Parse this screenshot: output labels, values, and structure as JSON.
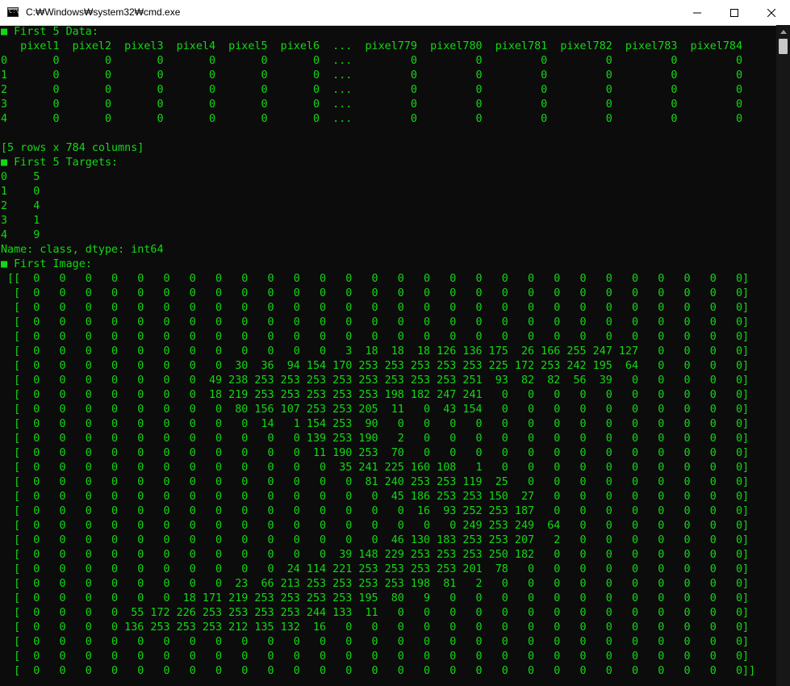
{
  "window": {
    "title": "C:₩Windows₩system32₩cmd.exe",
    "app_icon_label": "C:\\"
  },
  "console": {
    "lines": [
      "■ First 5 Data:",
      "   pixel1  pixel2  pixel3  pixel4  pixel5  pixel6  ...  pixel779  pixel780  pixel781  pixel782  pixel783  pixel784",
      "0       0       0       0       0       0       0  ...         0         0         0         0         0         0",
      "1       0       0       0       0       0       0  ...         0         0         0         0         0         0",
      "2       0       0       0       0       0       0  ...         0         0         0         0         0         0",
      "3       0       0       0       0       0       0  ...         0         0         0         0         0         0",
      "4       0       0       0       0       0       0  ...         0         0         0         0         0         0",
      "",
      "[5 rows x 784 columns]",
      "■ First 5 Targets:",
      "0    5",
      "1    0",
      "2    4",
      "3    1",
      "4    9",
      "Name: class, dtype: int64",
      "■ First Image:",
      " [[  0   0   0   0   0   0   0   0   0   0   0   0   0   0   0   0   0   0   0   0   0   0   0   0   0   0   0   0]",
      "  [  0   0   0   0   0   0   0   0   0   0   0   0   0   0   0   0   0   0   0   0   0   0   0   0   0   0   0   0]",
      "  [  0   0   0   0   0   0   0   0   0   0   0   0   0   0   0   0   0   0   0   0   0   0   0   0   0   0   0   0]",
      "  [  0   0   0   0   0   0   0   0   0   0   0   0   0   0   0   0   0   0   0   0   0   0   0   0   0   0   0   0]",
      "  [  0   0   0   0   0   0   0   0   0   0   0   0   0   0   0   0   0   0   0   0   0   0   0   0   0   0   0   0]",
      "  [  0   0   0   0   0   0   0   0   0   0   0   0   3  18  18  18 126 136 175  26 166 255 247 127   0   0   0   0]",
      "  [  0   0   0   0   0   0   0   0  30  36  94 154 170 253 253 253 253 253 225 172 253 242 195  64   0   0   0   0]",
      "  [  0   0   0   0   0   0   0  49 238 253 253 253 253 253 253 253 253 251  93  82  82  56  39   0   0   0   0   0]",
      "  [  0   0   0   0   0   0   0  18 219 253 253 253 253 253 198 182 247 241   0   0   0   0   0   0   0   0   0   0]",
      "  [  0   0   0   0   0   0   0   0  80 156 107 253 253 205  11   0  43 154   0   0   0   0   0   0   0   0   0   0]",
      "  [  0   0   0   0   0   0   0   0   0  14   1 154 253  90   0   0   0   0   0   0   0   0   0   0   0   0   0   0]",
      "  [  0   0   0   0   0   0   0   0   0   0   0 139 253 190   2   0   0   0   0   0   0   0   0   0   0   0   0   0]",
      "  [  0   0   0   0   0   0   0   0   0   0   0  11 190 253  70   0   0   0   0   0   0   0   0   0   0   0   0   0]",
      "  [  0   0   0   0   0   0   0   0   0   0   0   0  35 241 225 160 108   1   0   0   0   0   0   0   0   0   0   0]",
      "  [  0   0   0   0   0   0   0   0   0   0   0   0   0  81 240 253 253 119  25   0   0   0   0   0   0   0   0   0]",
      "  [  0   0   0   0   0   0   0   0   0   0   0   0   0   0  45 186 253 253 150  27   0   0   0   0   0   0   0   0]",
      "  [  0   0   0   0   0   0   0   0   0   0   0   0   0   0   0  16  93 252 253 187   0   0   0   0   0   0   0   0]",
      "  [  0   0   0   0   0   0   0   0   0   0   0   0   0   0   0   0   0 249 253 249  64   0   0   0   0   0   0   0]",
      "  [  0   0   0   0   0   0   0   0   0   0   0   0   0   0  46 130 183 253 253 207   2   0   0   0   0   0   0   0]",
      "  [  0   0   0   0   0   0   0   0   0   0   0   0  39 148 229 253 253 253 250 182   0   0   0   0   0   0   0   0]",
      "  [  0   0   0   0   0   0   0   0   0   0  24 114 221 253 253 253 253 201  78   0   0   0   0   0   0   0   0   0]",
      "  [  0   0   0   0   0   0   0   0  23  66 213 253 253 253 253 198  81   2   0   0   0   0   0   0   0   0   0   0]",
      "  [  0   0   0   0   0   0  18 171 219 253 253 253 253 195  80   9   0   0   0   0   0   0   0   0   0   0   0   0]",
      "  [  0   0   0   0  55 172 226 253 253 253 253 244 133  11   0   0   0   0   0   0   0   0   0   0   0   0   0   0]",
      "  [  0   0   0   0 136 253 253 253 212 135 132  16   0   0   0   0   0   0   0   0   0   0   0   0   0   0   0   0]",
      "  [  0   0   0   0   0   0   0   0   0   0   0   0   0   0   0   0   0   0   0   0   0   0   0   0   0   0   0   0]",
      "  [  0   0   0   0   0   0   0   0   0   0   0   0   0   0   0   0   0   0   0   0   0   0   0   0   0   0   0   0]",
      "  [  0   0   0   0   0   0   0   0   0   0   0   0   0   0   0   0   0   0   0   0   0   0   0   0   0   0   0   0]]"
    ]
  },
  "colors": {
    "console_background": "#0c0c0c",
    "console_text": "#13d813",
    "titlebar_background": "#ffffff"
  },
  "icons": {
    "app": "cmd-icon",
    "minimize": "minimize-icon",
    "maximize": "maximize-icon",
    "close": "close-icon",
    "scroll_up": "scroll-up-arrow-icon"
  }
}
